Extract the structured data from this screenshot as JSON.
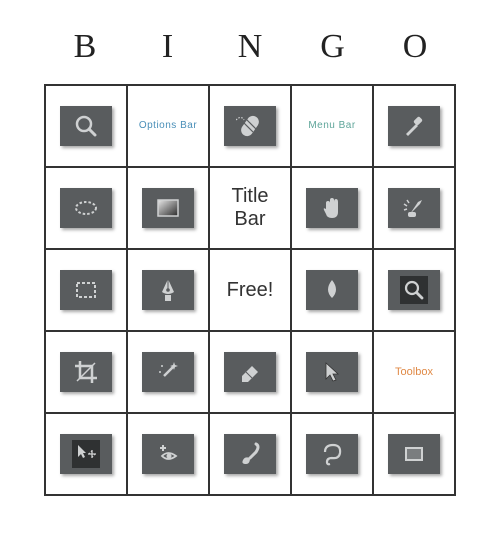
{
  "header": {
    "letters": [
      "B",
      "I",
      "N",
      "G",
      "O"
    ]
  },
  "grid": {
    "rows": [
      [
        {
          "type": "icon",
          "name": "zoom-icon"
        },
        {
          "type": "text",
          "style": "blue",
          "value": "Options  Bar",
          "name": "options-bar-label"
        },
        {
          "type": "icon",
          "name": "healing-brush-icon"
        },
        {
          "type": "text",
          "style": "teal",
          "value": "Menu  Bar",
          "name": "menu-bar-label"
        },
        {
          "type": "icon",
          "name": "eyedropper-icon"
        }
      ],
      [
        {
          "type": "icon",
          "name": "ellipse-select-icon"
        },
        {
          "type": "icon",
          "name": "gradient-icon"
        },
        {
          "type": "text",
          "style": "big",
          "value": "Title\nBar",
          "name": "title-bar-label"
        },
        {
          "type": "icon",
          "name": "hand-icon"
        },
        {
          "type": "icon",
          "name": "dodge-burn-icon"
        }
      ],
      [
        {
          "type": "icon",
          "name": "rectangle-select-icon"
        },
        {
          "type": "icon",
          "name": "pen-icon"
        },
        {
          "type": "text",
          "style": "big",
          "value": "Free!",
          "name": "free-space-label"
        },
        {
          "type": "icon",
          "name": "blur-icon"
        },
        {
          "type": "icon",
          "name": "zoom-dark-icon"
        }
      ],
      [
        {
          "type": "icon",
          "name": "crop-icon"
        },
        {
          "type": "icon",
          "name": "magic-wand-icon"
        },
        {
          "type": "icon",
          "name": "eraser-icon"
        },
        {
          "type": "icon",
          "name": "move-cursor-icon"
        },
        {
          "type": "text",
          "style": "orange",
          "value": "Toolbox",
          "name": "toolbox-label"
        }
      ],
      [
        {
          "type": "icon",
          "name": "move-tool-icon"
        },
        {
          "type": "icon",
          "name": "red-eye-icon"
        },
        {
          "type": "icon",
          "name": "brush-icon"
        },
        {
          "type": "icon",
          "name": "lasso-icon"
        },
        {
          "type": "icon",
          "name": "shape-rect-icon"
        }
      ]
    ]
  }
}
